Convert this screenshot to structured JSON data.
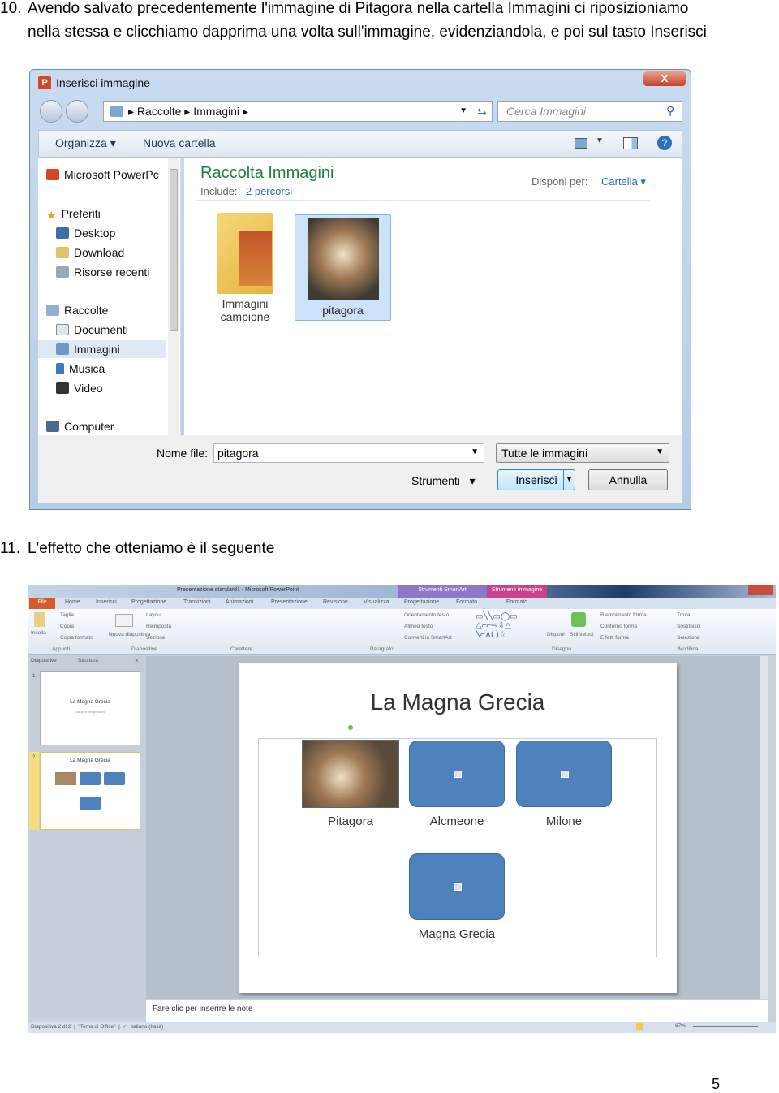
{
  "step10": {
    "number": "10.",
    "line1": "Avendo salvato precedentemente l'immagine di Pitagora nella cartella Immagini ci riposizioniamo",
    "line2": "nella stessa e clicchiamo dapprima una volta sull'immagine, evidenziandola,  e poi sul tasto Inserisci"
  },
  "dialog": {
    "title": "Inserisci immagine",
    "close": "X",
    "breadcrumb": [
      "Raccolte",
      "Immagini"
    ],
    "search_placeholder": "Cerca Immagini",
    "toolbar": {
      "organize": "Organizza",
      "new_folder": "Nuova cartella"
    },
    "nav": {
      "app": "Microsoft PowerPc",
      "favorites": "Preferiti",
      "desktop": "Desktop",
      "download": "Download",
      "recent": "Risorse recenti",
      "libraries": "Raccolte",
      "documents": "Documenti",
      "images": "Immagini",
      "music": "Musica",
      "video": "Video",
      "computer": "Computer"
    },
    "library_title": "Raccolta Immagini",
    "include_label": "Include:",
    "include_value": "2 percorsi",
    "arrange_label": "Disponi per:",
    "arrange_value": "Cartella",
    "items": [
      {
        "name": "Immagini campione",
        "type": "folder"
      },
      {
        "name": "pitagora",
        "type": "image",
        "selected": true
      }
    ],
    "filename_label": "Nome file:",
    "filename_value": "pitagora",
    "filter": "Tutte le immagini",
    "tools": "Strumenti",
    "insert": "Inserisci",
    "cancel": "Annulla"
  },
  "step11": {
    "number": "11.",
    "text": "L'effetto che otteniamo è il seguente"
  },
  "ppt": {
    "title": "Presentazione standard1 - Microsoft PowerPoint",
    "context_smartart": "Strumenti SmartArt",
    "context_image": "Strumenti immagine",
    "tabs": [
      "File",
      "Home",
      "Inserisci",
      "Progettazione",
      "Transizioni",
      "Animazioni",
      "Presentazione",
      "Revisione",
      "Visualizza",
      "Progettazione",
      "Formato",
      "Formato"
    ],
    "ribbon": {
      "paste": "Incolla",
      "cut": "Taglia",
      "copy": "Copia",
      "format_painter": "Copia formato",
      "clipboard": "Appunti",
      "new_slide": "Nuova diapositiva",
      "layout": "Layout",
      "reset": "Reimposta",
      "section": "Sezione",
      "slides_group": "Diapositive",
      "font_group": "Carattere",
      "paragraph_group": "Paragrafo",
      "text_direction": "Orientamento testo",
      "align_text": "Allinea testo",
      "convert_smartart": "Converti in SmartArt",
      "arrange": "Disponi",
      "quick_styles": "Stili veloci",
      "shape_fill": "Riempimento forma",
      "shape_outline": "Contorno forma",
      "shape_effects": "Effetti forma",
      "drawing_group": "Disegno",
      "find": "Trova",
      "replace": "Sostituisci",
      "select": "Seleziona",
      "editing_group": "Modifica"
    },
    "pane_tabs": [
      "Diapositive",
      "Struttura"
    ],
    "thumbs": [
      {
        "num": "1",
        "title": "La Magna Grecia",
        "subtitle": "Sviluppo del pensiero"
      },
      {
        "num": "2",
        "title": "La Magna Grecia"
      }
    ],
    "slide": {
      "title": "La Magna Grecia",
      "nodes": [
        "Pitagora",
        "Alcmeone",
        "Milone",
        "Magna Grecia"
      ]
    },
    "notes_placeholder": "Fare clic per inserire le note",
    "status": {
      "slide": "Diapositiva 2 di 2",
      "theme": "\"Tema di Office\"",
      "language": "Italiano (Italia)",
      "zoom": "67%"
    }
  },
  "page_number": "5"
}
